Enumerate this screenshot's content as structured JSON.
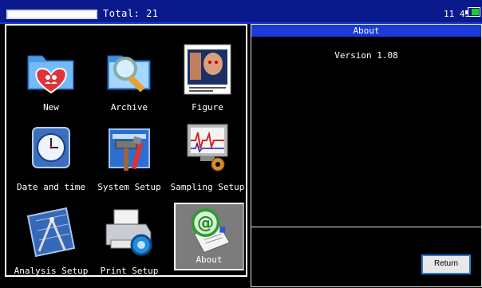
{
  "status": {
    "progress": 1.0,
    "total": "Total: 21",
    "time": "11 45"
  },
  "menu": {
    "items": [
      {
        "label": "New",
        "icon": "new-record-icon"
      },
      {
        "label": "Archive",
        "icon": "archive-search-icon"
      },
      {
        "label": "Figure",
        "icon": "figure-body-icon"
      },
      {
        "label": "Date and time",
        "icon": "clock-icon"
      },
      {
        "label": "System Setup",
        "icon": "tools-icon"
      },
      {
        "label": "Sampling Setup",
        "icon": "sampling-ecg-icon"
      },
      {
        "label": "Analysis Setup",
        "icon": "drafting-compass-icon"
      },
      {
        "label": "Print Setup",
        "icon": "printer-gear-icon"
      },
      {
        "label": "About",
        "icon": "email-at-icon"
      }
    ]
  },
  "about": {
    "title": "About",
    "version": "Version 1.08",
    "return_label": "Return"
  },
  "colors": {
    "topbar": "#0a1a8c",
    "title_bar": "#1a3ad9",
    "selected_tile": "#7c7c7c",
    "battery": "#17d117"
  }
}
